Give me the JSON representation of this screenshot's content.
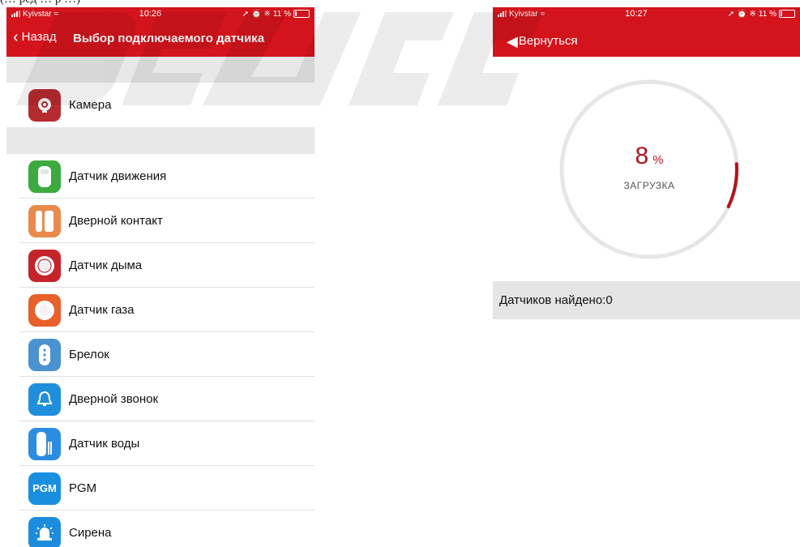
{
  "caption": "(… ред … р …)",
  "left_screen": {
    "status": {
      "carrier": "Kyivstar",
      "time": "10:26",
      "battery": "11 %"
    },
    "nav": {
      "back_label": "Назад",
      "title": "Выбор подключаемого датчика"
    },
    "camera_item": {
      "label": "Камера",
      "icon": "camera-icon",
      "color": "#b52a2f"
    },
    "devices": [
      {
        "label": "Датчик движения",
        "icon": "motion-sensor-icon",
        "color": "#3daa3f"
      },
      {
        "label": "Дверной контакт",
        "icon": "door-contact-icon",
        "color": "#e88b4c"
      },
      {
        "label": "Датчик дыма",
        "icon": "smoke-sensor-icon",
        "color": "#c6242b"
      },
      {
        "label": "Датчик газа",
        "icon": "gas-sensor-icon",
        "color": "#e8602a"
      },
      {
        "label": "Брелок",
        "icon": "key-fob-icon",
        "color": "#4a92d0"
      },
      {
        "label": "Дверной звонок",
        "icon": "doorbell-icon",
        "color": "#1f8fdc"
      },
      {
        "label": "Датчик воды",
        "icon": "water-sensor-icon",
        "color": "#2b8de0"
      },
      {
        "label": "PGM",
        "icon": "pgm-icon",
        "color": "#1a8fe0",
        "icon_text": "PGM"
      },
      {
        "label": "Сирена",
        "icon": "siren-icon",
        "color": "#1c8ddc"
      }
    ]
  },
  "right_screen": {
    "status": {
      "carrier": "Kyivstar",
      "time": "10:27",
      "battery": "11 %"
    },
    "nav": {
      "back_label": "Вернуться"
    },
    "progress": {
      "value": 8,
      "unit": "%",
      "label": "ЗАГРУЗКА",
      "fraction": 0.08
    },
    "found_text": "Датчиков найдено:0"
  },
  "colors": {
    "brand_red": "#d3141c",
    "progress_red": "#b5121b",
    "track_gray": "#e6e6e6",
    "section_gray": "#e8e8e8"
  }
}
